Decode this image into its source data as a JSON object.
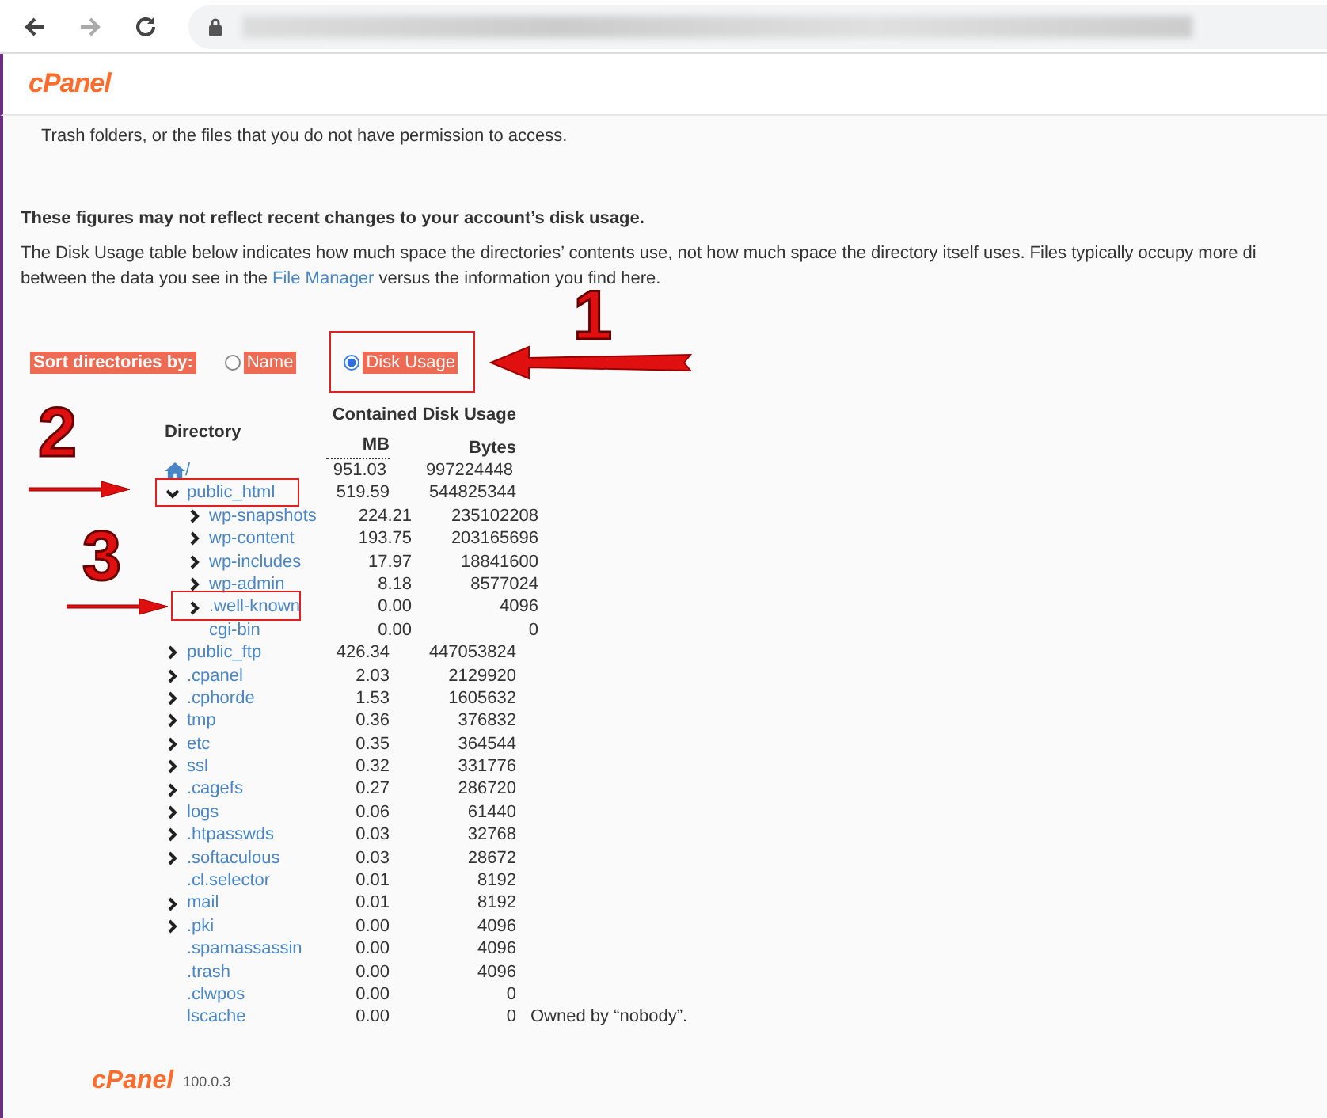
{
  "header": {
    "logo": "cPanel"
  },
  "intro": "Trash folders, or the files that you do not have permission to access.",
  "warning": "These figures may not reflect recent changes to your account’s disk usage.",
  "description": {
    "line1": "The Disk Usage table below indicates how much space the directories’ contents use, not how much space the directory itself uses. Files typically occupy more di",
    "before": "between the data you see in the",
    "link": "File Manager",
    "after": "versus the information you find here."
  },
  "sort": {
    "label": "Sort directories by:",
    "options": [
      {
        "label": "Name",
        "selected": false
      },
      {
        "label": "Disk Usage",
        "selected": true
      }
    ]
  },
  "table": {
    "directory_heading": "Directory",
    "group_heading": "Contained Disk Usage",
    "mb_heading": "MB",
    "bytes_heading": "Bytes",
    "root": {
      "name": "/",
      "mb": "951.03",
      "bytes": "997224448"
    },
    "rows": [
      {
        "name": "public_html",
        "kind": "folder",
        "expanded": true,
        "mb": "519.59",
        "bytes": "544825344",
        "children": [
          {
            "name": "wp-snapshots",
            "kind": "folder",
            "expanded": false,
            "mb": "224.21",
            "bytes": "235102208"
          },
          {
            "name": "wp-content",
            "kind": "folder",
            "expanded": false,
            "mb": "193.75",
            "bytes": "203165696"
          },
          {
            "name": "wp-includes",
            "kind": "folder",
            "expanded": false,
            "mb": "17.97",
            "bytes": "18841600"
          },
          {
            "name": "wp-admin",
            "kind": "folder",
            "expanded": false,
            "mb": "8.18",
            "bytes": "8577024"
          },
          {
            "name": ".well-known",
            "kind": "folder",
            "expanded": false,
            "mb": "0.00",
            "bytes": "4096"
          },
          {
            "name": "cgi-bin",
            "kind": "leaf",
            "mb": "0.00",
            "bytes": "0"
          }
        ]
      },
      {
        "name": "public_ftp",
        "kind": "folder",
        "expanded": false,
        "mb": "426.34",
        "bytes": "447053824"
      },
      {
        "name": ".cpanel",
        "kind": "folder",
        "expanded": false,
        "mb": "2.03",
        "bytes": "2129920"
      },
      {
        "name": ".cphorde",
        "kind": "folder",
        "expanded": false,
        "mb": "1.53",
        "bytes": "1605632"
      },
      {
        "name": "tmp",
        "kind": "folder",
        "expanded": false,
        "mb": "0.36",
        "bytes": "376832"
      },
      {
        "name": "etc",
        "kind": "folder",
        "expanded": false,
        "mb": "0.35",
        "bytes": "364544"
      },
      {
        "name": "ssl",
        "kind": "folder",
        "expanded": false,
        "mb": "0.32",
        "bytes": "331776"
      },
      {
        "name": ".cagefs",
        "kind": "folder",
        "expanded": false,
        "mb": "0.27",
        "bytes": "286720"
      },
      {
        "name": "logs",
        "kind": "folder",
        "expanded": false,
        "mb": "0.06",
        "bytes": "61440"
      },
      {
        "name": ".htpasswds",
        "kind": "folder",
        "expanded": false,
        "mb": "0.03",
        "bytes": "32768"
      },
      {
        "name": ".softaculous",
        "kind": "folder",
        "expanded": false,
        "mb": "0.03",
        "bytes": "28672"
      },
      {
        "name": ".cl.selector",
        "kind": "leaf",
        "mb": "0.01",
        "bytes": "8192"
      },
      {
        "name": "mail",
        "kind": "folder",
        "expanded": false,
        "mb": "0.01",
        "bytes": "8192"
      },
      {
        "name": ".pki",
        "kind": "folder",
        "expanded": false,
        "mb": "0.00",
        "bytes": "4096"
      },
      {
        "name": ".spamassassin",
        "kind": "leaf",
        "mb": "0.00",
        "bytes": "4096"
      },
      {
        "name": ".trash",
        "kind": "leaf",
        "mb": "0.00",
        "bytes": "4096"
      },
      {
        "name": ".clwpos",
        "kind": "leaf",
        "mb": "0.00",
        "bytes": "0"
      },
      {
        "name": "lscache",
        "kind": "leaf",
        "mb": "0.00",
        "bytes": "0",
        "note": "Owned by “nobody”."
      }
    ]
  },
  "annotations": [
    "1",
    "2",
    "3"
  ],
  "footer": {
    "logo": "cPanel",
    "version": "100.0.3"
  }
}
